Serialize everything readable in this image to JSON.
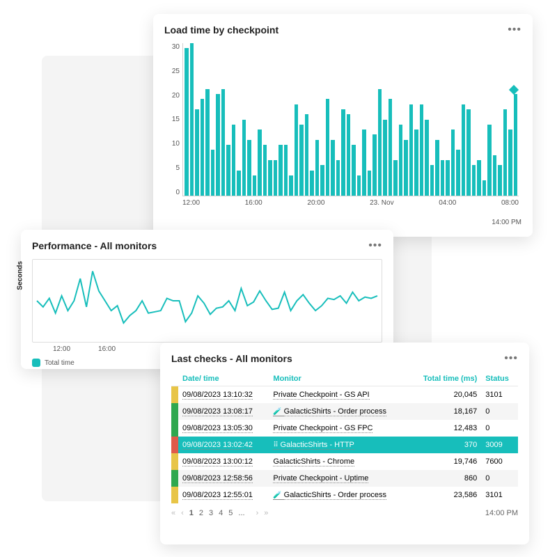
{
  "colors": {
    "teal": "#17bebb",
    "green": "#2fa84f",
    "yellow": "#e8c547",
    "red": "#e05b4a"
  },
  "load_time_card": {
    "title": "Load time by checkpoint",
    "timestamp": "14:00 PM"
  },
  "performance_card": {
    "title": "Performance - All monitors",
    "y_label": "Seconds",
    "legend": "Total time",
    "x_ticks": [
      "12:00",
      "16:00"
    ]
  },
  "checks_card": {
    "title": "Last checks - All monitors",
    "headers": {
      "datetime": "Date/ time",
      "monitor": "Monitor",
      "total": "Total time (ms)",
      "status": "Status"
    },
    "rows": [
      {
        "color": "yellow",
        "dt": "09/08/2023 13:10:32",
        "monitor": "Private Checkpoint - GS API",
        "icon": "",
        "total": "20,045",
        "status": "3101",
        "selected": false
      },
      {
        "color": "green",
        "dt": "09/08/2023 13:08:17",
        "monitor": "GalacticShirts - Order process",
        "icon": "🧪",
        "total": "18,167",
        "status": "0",
        "selected": false
      },
      {
        "color": "green",
        "dt": "09/08/2023 13:05:30",
        "monitor": "Private Checkpoint - GS FPC",
        "icon": "",
        "total": "12,483",
        "status": "0",
        "selected": false
      },
      {
        "color": "red",
        "dt": "09/08/2023 13:02:42",
        "monitor": "GalacticShirts - HTTP",
        "icon": "⠿",
        "total": "370",
        "status": "3009",
        "selected": true
      },
      {
        "color": "yellow",
        "dt": "09/08/2023 13:00:12",
        "monitor": "GalacticShirts - Chrome",
        "icon": "",
        "total": "19,746",
        "status": "7600",
        "selected": false
      },
      {
        "color": "green",
        "dt": "09/08/2023 12:58:56",
        "monitor": "Private Checkpoint - Uptime",
        "icon": "",
        "total": "860",
        "status": "0",
        "selected": false
      },
      {
        "color": "yellow",
        "dt": "09/08/2023 12:55:01",
        "monitor": "GalacticShirts - Order process",
        "icon": "🧪",
        "total": "23,586",
        "status": "3101",
        "selected": false
      }
    ],
    "pages": [
      "1",
      "2",
      "3",
      "4",
      "5",
      "..."
    ],
    "timestamp": "14:00 PM"
  },
  "chart_data": [
    {
      "type": "bar",
      "title": "Load time by checkpoint",
      "ylabel": "",
      "xlabel": "",
      "ylim": [
        0,
        30
      ],
      "y_ticks": [
        30,
        25,
        20,
        15,
        10,
        5,
        0
      ],
      "x_ticks": [
        "12:00",
        "16:00",
        "20:00",
        "23. Nov",
        "04:00",
        "08:00"
      ],
      "values": [
        29,
        30,
        17,
        19,
        21,
        9,
        20,
        21,
        10,
        14,
        5,
        15,
        11,
        4,
        13,
        10,
        7,
        7,
        10,
        10,
        4,
        18,
        14,
        16,
        5,
        11,
        6,
        19,
        11,
        7,
        17,
        16,
        10,
        4,
        13,
        5,
        12,
        21,
        15,
        19,
        7,
        14,
        11,
        18,
        13,
        18,
        15,
        6,
        11,
        7,
        7,
        13,
        9,
        18,
        17,
        6,
        7,
        3,
        14,
        8,
        6,
        17,
        13,
        20
      ],
      "marker_value": 21
    },
    {
      "type": "line",
      "title": "Performance - All monitors",
      "ylabel": "Seconds",
      "xlabel": "",
      "x_ticks": [
        "12:00",
        "16:00"
      ],
      "series": [
        {
          "name": "Total time",
          "values": [
            6,
            5.5,
            6.2,
            5.0,
            6.4,
            5.2,
            6,
            7.8,
            5.5,
            8.4,
            6.8,
            6.0,
            5.2,
            5.6,
            4.2,
            4.8,
            5.2,
            6.0,
            5.0,
            5.1,
            5.2,
            6.2,
            6.0,
            6.0,
            4.3,
            5.0,
            6.4,
            5.8,
            4.9,
            5.4,
            5.5,
            6.0,
            5.2,
            7.0,
            5.6,
            5.9,
            6.8,
            6.0,
            5.3,
            5.4,
            6.7,
            5.2,
            6.0,
            6.5,
            5.8,
            5.2,
            5.6,
            6.2,
            6.1,
            6.4,
            5.8,
            6.7,
            6.0,
            6.3,
            6.2,
            6.4
          ]
        }
      ],
      "ylim": [
        3,
        9
      ]
    }
  ]
}
